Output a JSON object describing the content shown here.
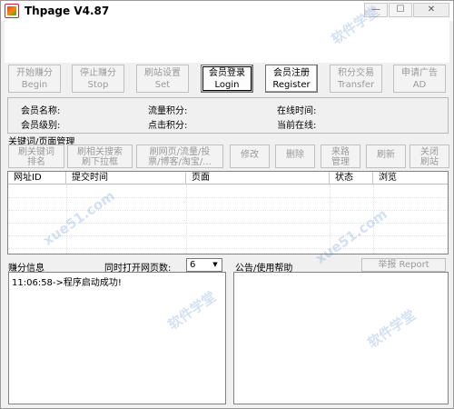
{
  "window": {
    "title": "Thpage V4.87"
  },
  "toolbar": {
    "buttons": [
      {
        "line1": "开始赚分",
        "line2": "Begin",
        "enabled": false
      },
      {
        "line1": "停止赚分",
        "line2": "Stop",
        "enabled": false
      },
      {
        "line1": "刷站设置",
        "line2": "Set",
        "enabled": false
      },
      {
        "line1": "会员登录",
        "line2": "Login",
        "enabled": true
      },
      {
        "line1": "会员注册",
        "line2": "Register",
        "enabled": true
      },
      {
        "line1": "积分交易",
        "line2": "Transfer",
        "enabled": false
      },
      {
        "line1": "申请广告",
        "line2": "AD",
        "enabled": false
      }
    ]
  },
  "member_info": {
    "name_label": "会员名称:",
    "traffic_label": "流量积分:",
    "online_time_label": "在线时间:",
    "level_label": "会员级别:",
    "click_label": "点击积分:",
    "current_online_label": "当前在线:"
  },
  "keyword_section": {
    "title": "关键词/页面管理",
    "buttons": [
      {
        "line1": "刷关键词",
        "line2": "排名"
      },
      {
        "line1": "刷相关搜索",
        "line2": "刷下拉框"
      },
      {
        "line1": "刷网页/流量/投",
        "line2": "票/博客/淘宝/..."
      },
      {
        "line1": "修改",
        "line2": ""
      },
      {
        "line1": "删除",
        "line2": ""
      },
      {
        "line1": "来路",
        "line2": "管理"
      },
      {
        "line1": "刷新",
        "line2": ""
      },
      {
        "line1": "关闭",
        "line2": "刷站"
      }
    ]
  },
  "grid": {
    "columns": [
      "网址ID",
      "提交时间",
      "页面",
      "状态",
      "浏览"
    ]
  },
  "earn": {
    "label": "赚分信息",
    "pages_label": "同时打开网页数:",
    "pages_value": "6",
    "log": [
      "11:06:58->程序启动成功!"
    ]
  },
  "notice": {
    "label": "公告/使用帮助",
    "report_button": "举报 Report"
  },
  "watermark": "软件学堂 xue51.com",
  "colors": {
    "watermark": "#3c78c8",
    "disabled_text": "#9a9a9a"
  }
}
